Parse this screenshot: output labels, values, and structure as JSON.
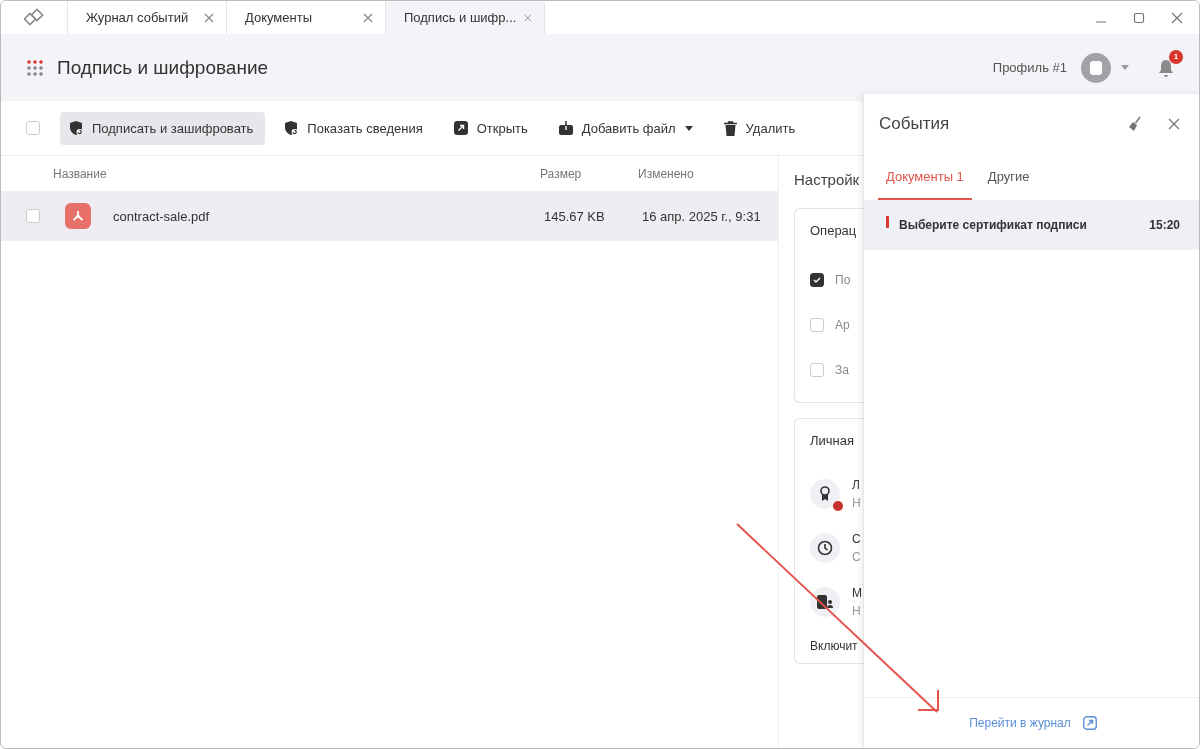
{
  "window": {
    "tabs": [
      {
        "label": "Журнал событий",
        "selected": false
      },
      {
        "label": "Документы",
        "selected": false
      },
      {
        "label": "Подпись и шифр...",
        "selected": true
      }
    ]
  },
  "header": {
    "title": "Подпись и шифрование",
    "profile_name": "Профиль #1",
    "notification_count": "1"
  },
  "toolbar": {
    "select_all_checked": false,
    "buttons": [
      {
        "label": "Подписать и зашифровать",
        "highlighted": true,
        "has_dropdown": false
      },
      {
        "label": "Показать сведения",
        "highlighted": false,
        "has_dropdown": false
      },
      {
        "label": "Открыть",
        "highlighted": false,
        "has_dropdown": false
      },
      {
        "label": "Добавить файл",
        "highlighted": false,
        "has_dropdown": true
      },
      {
        "label": "Удалить",
        "highlighted": false,
        "has_dropdown": false
      }
    ]
  },
  "files": {
    "columns": [
      "Название",
      "Размер",
      "Изменено"
    ],
    "rows": [
      {
        "name": "contract-sale.pdf",
        "size": "145.67 KB",
        "modified": "16 апр. 2025 г., 9:31",
        "selected": true,
        "checked": false
      }
    ]
  },
  "settings": {
    "title": "Настройк",
    "operations": {
      "title": "Операц",
      "options": [
        {
          "label": "По",
          "checked": true
        },
        {
          "label": "Ар",
          "checked": false
        },
        {
          "label": "За",
          "checked": false
        }
      ]
    },
    "personal": {
      "title": "Личная",
      "items": [
        {
          "title": "Л",
          "subtitle": "Н",
          "warning": true
        },
        {
          "title": "С",
          "subtitle": "С",
          "warning": false
        },
        {
          "title": "М",
          "subtitle": "Н",
          "warning": false
        }
      ],
      "footer": "Включит"
    }
  },
  "events": {
    "title": "События",
    "tabs": [
      {
        "label": "Документы 1",
        "selected": true
      },
      {
        "label": "Другие",
        "selected": false
      }
    ],
    "items": [
      {
        "message": "Выберите сертификат подписи",
        "time": "15:20",
        "error": true
      }
    ],
    "footer_link": "Перейти в журнал"
  }
}
